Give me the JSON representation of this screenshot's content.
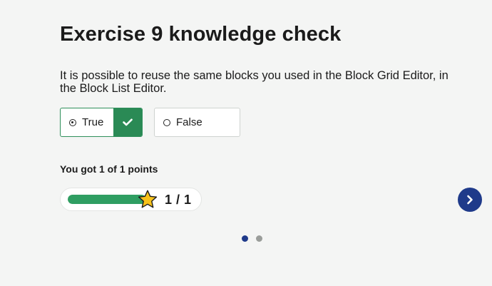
{
  "quiz": {
    "title": "Exercise 9 knowledge check",
    "question": "It is possible to reuse the same blocks you used in the Block Grid Editor, in the Block List Editor.",
    "options": [
      {
        "label": "True",
        "selected": true,
        "correct": true
      },
      {
        "label": "False",
        "selected": false,
        "correct": false
      }
    ]
  },
  "result": {
    "text": "You got 1 of 1 points",
    "score_display": "1 / 1",
    "progress_fraction": 1.0
  },
  "pagination": {
    "total": 2,
    "current": 1
  },
  "colors": {
    "accent_green": "#2a8a55",
    "progress_green": "#2f9e62",
    "nav_blue": "#1f3a8a",
    "star_yellow": "#f7c21a"
  },
  "icons": {
    "check": "check-icon",
    "star": "star-icon",
    "next": "chevron-right-icon"
  }
}
